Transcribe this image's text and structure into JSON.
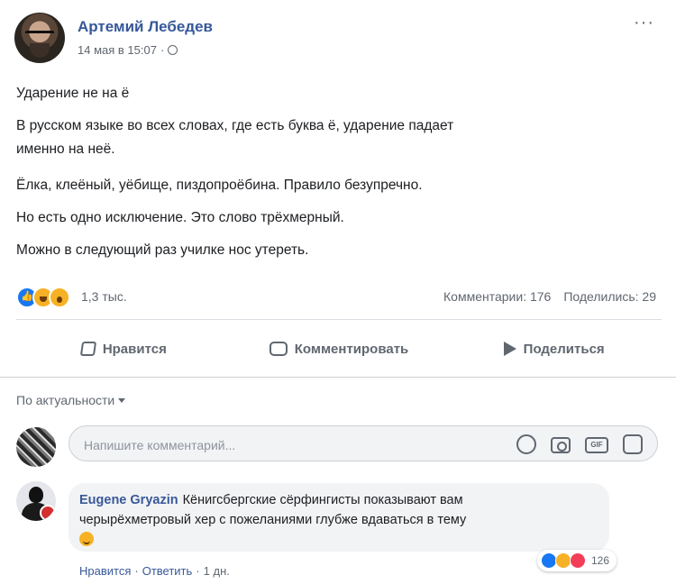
{
  "post": {
    "author": "Артемий Лебедев",
    "date": "14 мая в 15:07",
    "separator": "·",
    "more": "···",
    "paragraphs": [
      "Ударение не на ё",
      "В русском языке во всех словах, где есть буква ё, ударение падает",
      "именно на неё.",
      "Ёлка, клеёный, уёбище, пиздопроёбина. Правило безупречно.",
      "Но есть одно исключение. Это слово трёхмерный.",
      "Можно в следующий раз училке нос утереть."
    ]
  },
  "stats": {
    "reactions_count": "1,3 тыс.",
    "comments": "Комментарии: 176",
    "shares": "Поделились: 29"
  },
  "actions": {
    "like": "Нравится",
    "comment": "Комментировать",
    "share": "Поделиться"
  },
  "sort": {
    "label": "По актуальности"
  },
  "composer": {
    "placeholder": "Напишите комментарий...",
    "gif_label": "GIF"
  },
  "comment": {
    "author": "Eugene Gryazin",
    "text_line1": "Кёнигсбергские сёрфингисты показывают вам",
    "text_line2": "черырёхметровый хер с пожеланиями глубже вдаваться в тему",
    "reactions_count": "126",
    "like": "Нравится",
    "reply": "Ответить",
    "time": "1 дн.",
    "separator": "·"
  }
}
